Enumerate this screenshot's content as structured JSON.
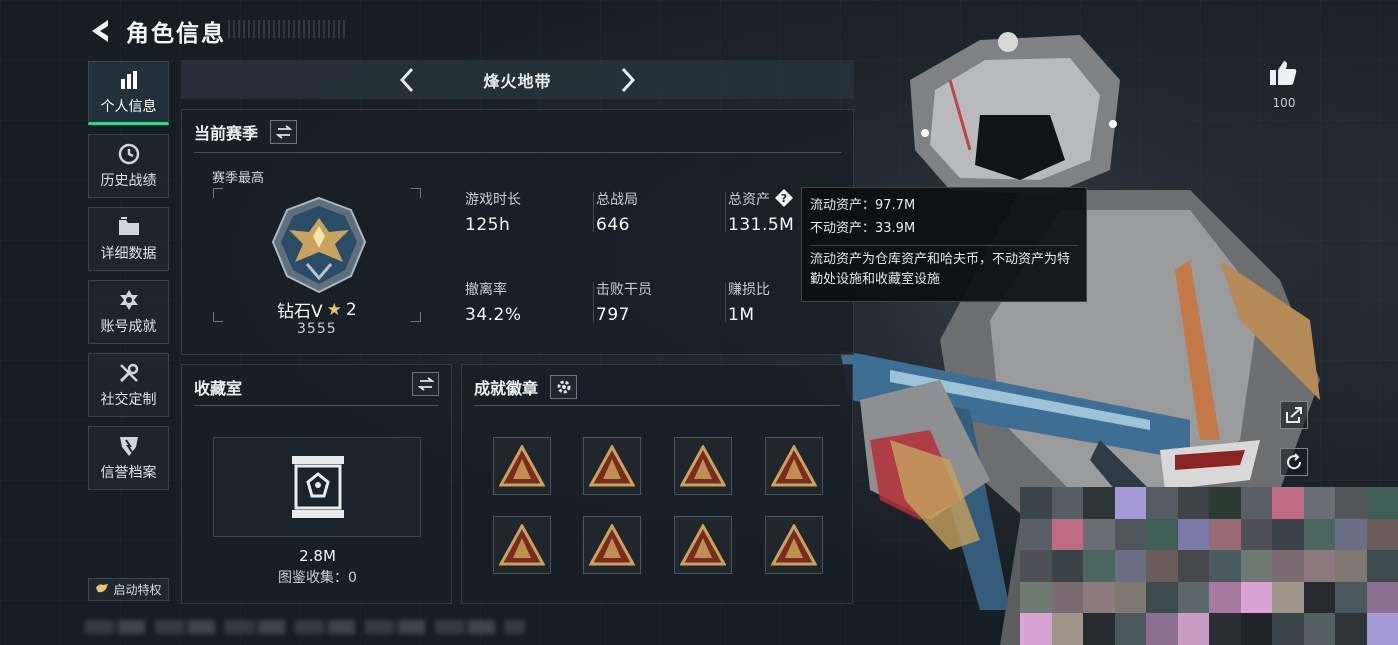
{
  "header": {
    "title": "角色信息"
  },
  "nav": {
    "items": [
      {
        "label": "个人信息",
        "icon": "bar-chart-icon"
      },
      {
        "label": "历史战绩",
        "icon": "history-clock-icon"
      },
      {
        "label": "详细数据",
        "icon": "folder-icon"
      },
      {
        "label": "账号成就",
        "icon": "achievement-gear-icon"
      },
      {
        "label": "社交定制",
        "icon": "tools-icon"
      },
      {
        "label": "信誉档案",
        "icon": "shield-badge-icon"
      }
    ],
    "active_index": 0,
    "privilege_label": "启动特权"
  },
  "mode": {
    "name": "烽火地带"
  },
  "season": {
    "title": "当前赛季",
    "best_label": "赛季最高",
    "rank_name": "钻石V",
    "rank_stars": "2",
    "rank_score": "3555",
    "stats": [
      {
        "label": "游戏时长",
        "value": "125h"
      },
      {
        "label": "总战局",
        "value": "646"
      },
      {
        "label": "总资产",
        "value": "131.5M"
      },
      {
        "label": "撤离率",
        "value": "34.2%"
      },
      {
        "label": "击败干员",
        "value": "797"
      },
      {
        "label": "赚损比",
        "value": "1M"
      }
    ]
  },
  "tooltip": {
    "liquid": "流动资产：97.7M",
    "fixed": "不动资产：33.9M",
    "desc": "流动资产为仓库资产和哈夫币，不动资产为特勤处设施和收藏室设施"
  },
  "collection": {
    "title": "收藏室",
    "value": "2.8M",
    "catalog": "图鉴收集：0"
  },
  "badges": {
    "title": "成就徽章",
    "icons": [
      "bottle-badge-icon",
      "ship-badge-icon",
      "mask-badge-icon",
      "sitting-figure-badge-icon",
      "hand-sign-badge-icon",
      "crowd-badge-icon",
      "tank-badge-icon",
      "keycard-badge-icon"
    ]
  },
  "social": {
    "like_count": "100"
  },
  "colors": {
    "accent_green": "#2fd58a",
    "badge_gold": "#c9a25c",
    "badge_red": "#7a2a1e",
    "panel_bg": "#182027"
  }
}
